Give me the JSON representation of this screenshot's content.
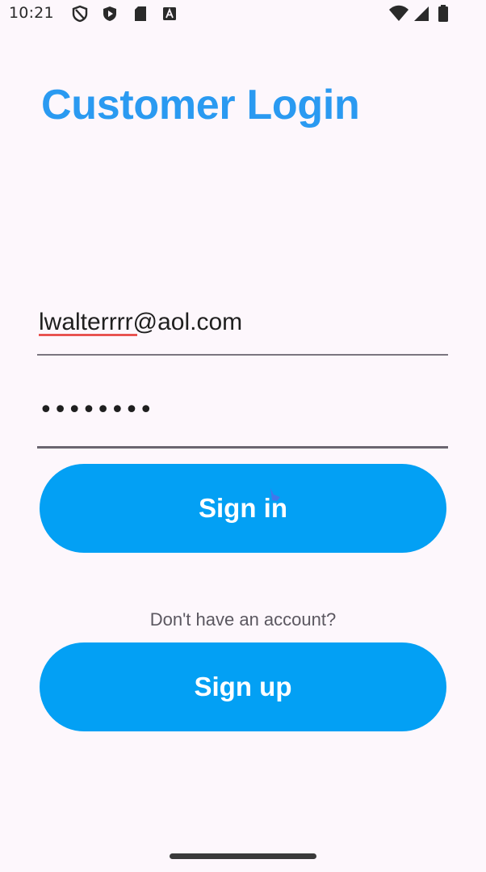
{
  "status_bar": {
    "time": "10:21",
    "left_icons": [
      "shield-icon",
      "play-protect-icon",
      "sd-card-icon",
      "a-badge-icon"
    ],
    "right_icons": [
      "wifi-icon",
      "cellular-signal-icon",
      "battery-icon"
    ]
  },
  "login": {
    "title": "Customer Login",
    "email_value": "lwalterrrr@aol.com",
    "password_value": "••••••••",
    "signin_label": "Sign in",
    "no_account_text": "Don't have an account?",
    "signup_label": "Sign up"
  },
  "colors": {
    "title": "#2a9af1",
    "button": "#03a0f4",
    "background": "#fdf7fc",
    "spellcheck_underline": "#e53935"
  }
}
